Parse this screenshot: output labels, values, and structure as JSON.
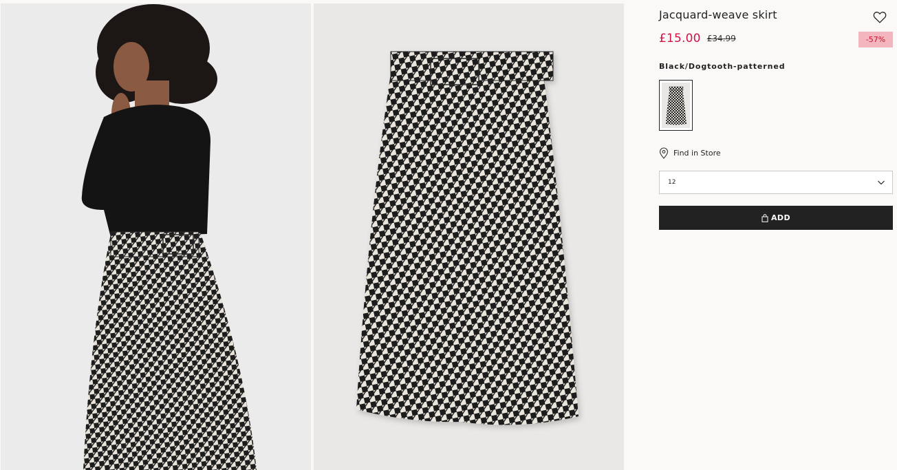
{
  "gallery": {
    "images": [
      {
        "name": "model-back-view",
        "alt": ""
      },
      {
        "name": "skirt-flat-lay",
        "alt": ""
      }
    ]
  },
  "product": {
    "title": "Jacquard-weave skirt",
    "price_current": "£15.00",
    "price_old": "£34.99",
    "discount": "-57%",
    "color_name": "Black/Dogtooth-patterned",
    "find_in_store": "Find in Store",
    "size_selected": "12",
    "add_label": "ADD"
  },
  "colors": {
    "price_sale": "#d01345",
    "discount_bg": "#f4b6be",
    "discount_text": "#c7112e",
    "add_button_bg": "#222222"
  },
  "icons": {
    "favorite": "heart-icon",
    "store": "location-pin-icon",
    "dropdown": "chevron-down-icon",
    "add": "shopping-bag-icon"
  }
}
